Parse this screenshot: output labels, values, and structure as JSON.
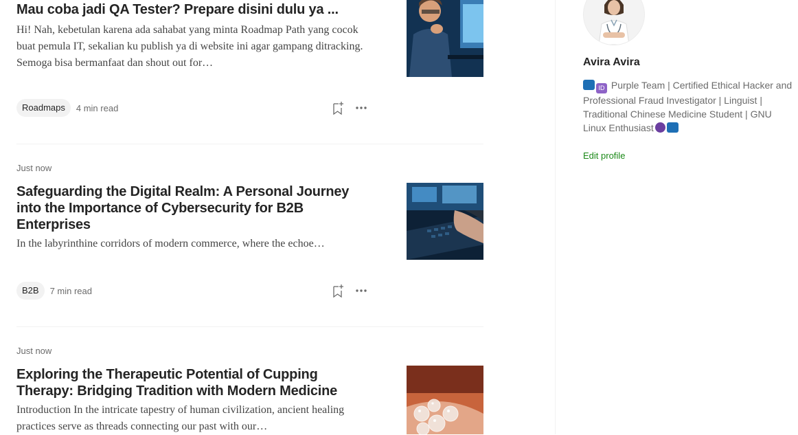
{
  "articles": [
    {
      "time": "",
      "title": "Mau coba jadi QA Tester? Prepare disini dulu ya ...",
      "excerpt": "Hi! Nah, kebetulan karena ada sahabat yang minta Roadmap Path yang cocok buat pemula IT, sekalian ku publish ya di website ini agar gampang ditracking. Semoga bisa bermanfaat dan shout out for…",
      "tag": "Roadmaps",
      "read_time": "4 min read",
      "image": "person-at-computer-image"
    },
    {
      "time": "Just now",
      "title": "Safeguarding the Digital Realm: A Personal Journey into the Importance of Cybersecurity for B2B Enterprises",
      "excerpt": "In the labyrinthine corridors of modern commerce, where the echoe…",
      "tag": "B2B",
      "read_time": "7 min read",
      "image": "hands-on-keyboard-image"
    },
    {
      "time": "Just now",
      "title": "Exploring the Therapeutic Potential of Cupping Therapy: Bridging Tradition with Modern Medicine",
      "excerpt": "Introduction In the intricate tapestry of human civilization, ancient healing practices serve as threads connecting our past with our…",
      "image": "cupping-glasses-image"
    }
  ],
  "profile": {
    "name": "Avira Avira",
    "bio_text": "Purple Team | Certified Ethical Hacker and Professional Fraud Investigator | Linguist | Traditional Chinese Medicine Student | GNU Linux Enthusiast",
    "edit_label": "Edit profile",
    "avatar": "doctor-avatar-image"
  },
  "colors": {
    "accent_green": "#1a8917",
    "text_primary": "#242424",
    "text_secondary": "#6b6b6b",
    "tag_bg": "#f2f2f2"
  }
}
